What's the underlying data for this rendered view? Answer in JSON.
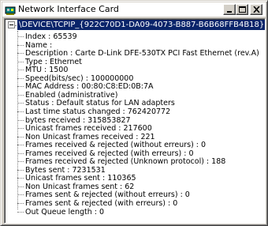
{
  "window": {
    "title": "Network Interface Card",
    "icon": "network-card-icon",
    "buttons": [
      "minimize",
      "maximize",
      "close"
    ]
  },
  "tree": {
    "root": "\\DEVICE\\TCPIP_{922C70D1-DA09-4073-B887-B6B68FFB4B18}",
    "items": [
      "Index : 65539",
      "Name :",
      "Description : Carte D-Link DFE-530TX PCI Fast Ethernet (rev.A)",
      "Type : Ethernet",
      "MTU : 1500",
      "Speed(bits/sec) : 100000000",
      "MAC Address : 00:80:C8:ED:0B:7A",
      "Enabled (administrative)",
      "Status : Default status for LAN adapters",
      "Last time status changed : 762420772",
      "bytes received : 315853827",
      "Unicast frames received : 217600",
      "Non Unicast frames received : 221",
      "Frames received & rejected (without erreurs) : 0",
      "Frames received & rejected (with erreurs) : 0",
      "Frames received & rejected (Unknown protocol) : 188",
      "Bytes sent : 7231531",
      "Unicast frames sent : 110365",
      "Non Unicast frames sent : 62",
      "Frames sent & rejected (without erreurs) : 0",
      "Frames sent & rejected (with erreurs) : 0",
      "Out Queue length : 0"
    ]
  },
  "colors": {
    "selection": "#0a246a",
    "face": "#d4d0c8"
  }
}
